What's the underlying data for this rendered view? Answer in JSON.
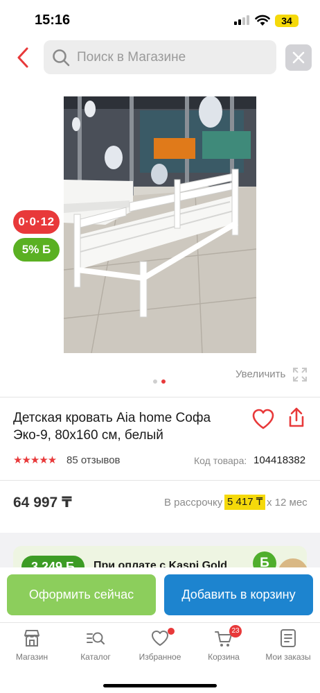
{
  "status_bar": {
    "time": "15:16",
    "battery": "34"
  },
  "search": {
    "placeholder": "Поиск в Магазине"
  },
  "badges": {
    "promo": "0·0·12",
    "bonus": "5% Б"
  },
  "gallery": {
    "zoom_label": "Увеличить"
  },
  "product": {
    "title": "Детская кровать Aia home Софа Эко-9, 80x160 см, белый",
    "rating_stars": "★★★★★",
    "reviews": "85 отзывов",
    "sku_label": "Код товара:",
    "sku": "104418382",
    "price": "64 997 ₸",
    "installment_label": "В рассрочку",
    "installment_amount": "5 417 ₸",
    "installment_months": "x 12 мес"
  },
  "kaspi_promo": {
    "bonus": "3 249 Б",
    "text": "При оплате с Kaspi Gold",
    "coin": "Б"
  },
  "actions": {
    "buy_now": "Оформить сейчас",
    "add_to_cart": "Добавить в корзину"
  },
  "tabs": [
    {
      "label": "Магазин",
      "icon": "store-icon"
    },
    {
      "label": "Каталог",
      "icon": "catalog-search-icon"
    },
    {
      "label": "Избранное",
      "icon": "heart-icon"
    },
    {
      "label": "Корзина",
      "icon": "cart-icon",
      "badge": "23"
    },
    {
      "label": "Мои заказы",
      "icon": "orders-icon"
    }
  ],
  "colors": {
    "accent_red": "#e8393a",
    "bonus_green": "#5ab022",
    "buy_button": "#8cce5c",
    "cart_button": "#1d84cf",
    "installment_highlight": "#f5d90a"
  }
}
